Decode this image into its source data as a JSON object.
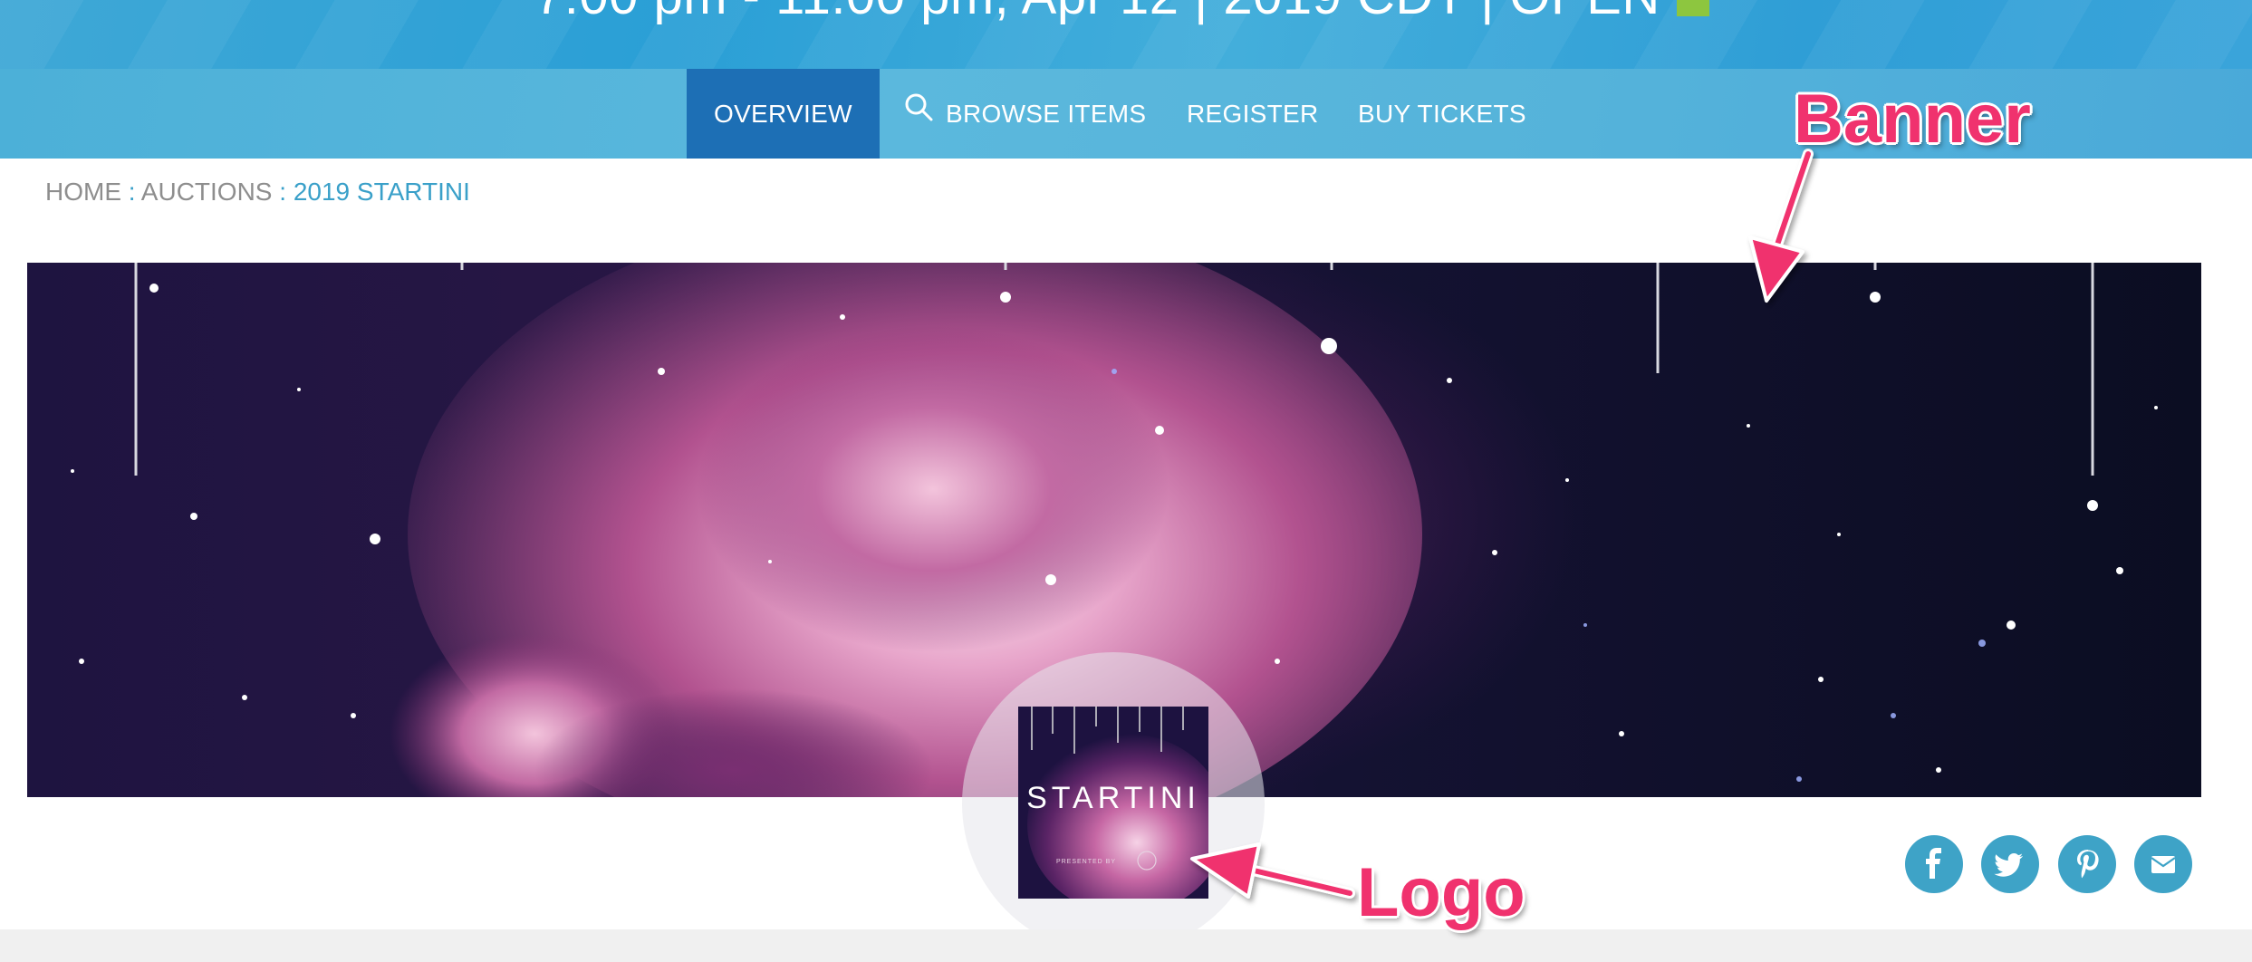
{
  "header": {
    "event_time": "7:00 pm - 11:00 pm, Apr 12 | 2019 CDT | OPEN"
  },
  "nav": {
    "tabs": [
      {
        "label": "OVERVIEW",
        "active": true
      },
      {
        "label": "BROWSE ITEMS",
        "icon": "search-icon"
      },
      {
        "label": "REGISTER"
      },
      {
        "label": "BUY TICKETS"
      }
    ]
  },
  "breadcrumb": {
    "items": [
      "HOME",
      "AUCTIONS",
      "2019 STARTINI"
    ],
    "separator": ":"
  },
  "logo": {
    "title": "STARTINI",
    "presented_by": "PRESENTED BY"
  },
  "share": [
    {
      "icon": "facebook-icon"
    },
    {
      "icon": "twitter-icon"
    },
    {
      "icon": "pinterest-icon"
    },
    {
      "icon": "email-icon"
    }
  ],
  "annotations": {
    "banner": "Banner",
    "logo": "Logo"
  },
  "colors": {
    "header_blue": "#2a9fd6",
    "active_tab": "#1d6fb5",
    "link_teal": "#3aa0c9",
    "share_button": "#3ea3c7",
    "annotation_pink": "#f0326e",
    "status_green": "#8dc63f"
  }
}
